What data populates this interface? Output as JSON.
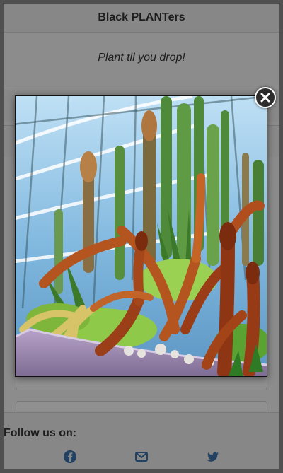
{
  "header": {
    "title": "Black PLANTers"
  },
  "tagline": "Plant til you drop!",
  "footer": {
    "follow_label": "Follow us on:",
    "social": [
      "facebook-icon",
      "email-icon",
      "twitter-icon"
    ]
  },
  "popup": {
    "image_icon": "cactus-photo",
    "close_icon": "close-icon"
  },
  "colors": {
    "social_blue": "#3b6fa8",
    "overlay": "#000000"
  }
}
